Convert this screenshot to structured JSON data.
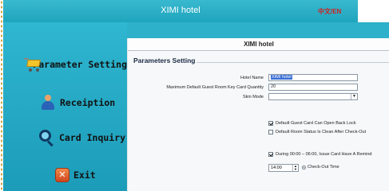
{
  "window": {
    "title": "XIMI hotel",
    "lang_toggle": "中文/EN"
  },
  "sidebar": {
    "items": [
      {
        "label": "Parameter Setting",
        "icon": "cart-icon"
      },
      {
        "label": "Receiption",
        "icon": "person-icon"
      },
      {
        "label": "Card Inquiry",
        "icon": "magnifier-icon"
      },
      {
        "label": "Exit",
        "icon": "exit-icon"
      }
    ]
  },
  "main": {
    "header_title": "XIMI hotel",
    "section_title": "Parameters Setting",
    "fields": {
      "hotel_name_label": "Hotel Name",
      "hotel_name_value": "XIMI hotel",
      "max_cards_label": "Maximum Default Guest Room Key Card Quantity",
      "max_cards_value": "20",
      "skin_mode_label": "Skin Mode",
      "skin_mode_value": ""
    },
    "checkboxes": [
      {
        "label": "Default Guest Card Can Open Back Lock",
        "checked": true
      },
      {
        "label": "Default Room Status Is Clean After Check-Out",
        "checked": false
      },
      {
        "label": "During 00:00 – 06:00, Issue Card Have A Remind",
        "checked": true
      }
    ],
    "checkout_time": {
      "value": "14:00",
      "label": "Check-Out Time",
      "selected": true
    }
  },
  "colors": {
    "accent": "#1ea5bd",
    "sidebar": "#2fb6d1",
    "lang": "#d21f1f"
  }
}
